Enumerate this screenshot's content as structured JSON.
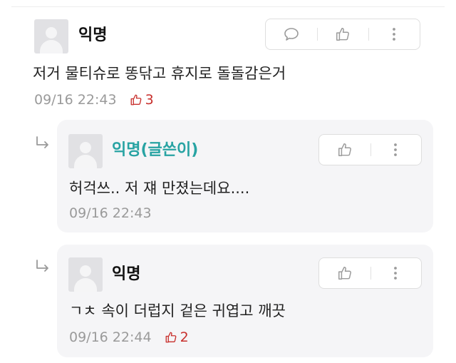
{
  "colors": {
    "author_name": "#28a3a3",
    "like_red": "#c8302d",
    "meta_gray": "#9a9a9a",
    "reply_bg": "#f5f5f7"
  },
  "comment": {
    "name": "익명",
    "text": "저거 물티슈로 똥닦고 휴지로 돌돌감은거",
    "time": "09/16 22:43",
    "likes": "3",
    "actions": [
      "comment-icon",
      "thumbs-up-icon",
      "more-vertical-icon"
    ]
  },
  "replies": [
    {
      "name": "익명(글쓴이)",
      "is_author": true,
      "text": "허걱쓰.. 저 쟤 만졌는데요....",
      "time": "09/16 22:43",
      "actions": [
        "thumbs-up-icon",
        "more-vertical-icon"
      ]
    },
    {
      "name": "익명",
      "is_author": false,
      "text": "ㄱㅊ 속이 더럽지 겉은 귀엽고 깨끗",
      "time": "09/16 22:44",
      "likes": "2",
      "actions": [
        "thumbs-up-icon",
        "more-vertical-icon"
      ]
    }
  ]
}
